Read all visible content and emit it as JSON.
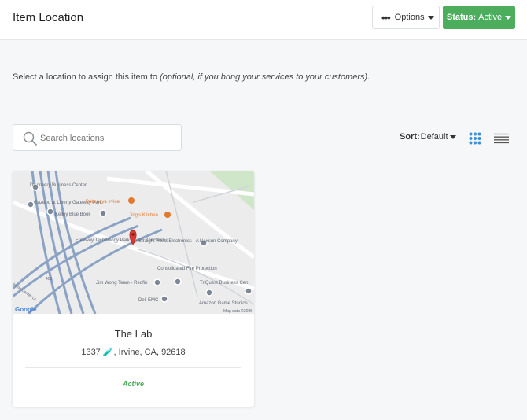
{
  "header": {
    "title": "Item Location",
    "options_label": "Options",
    "status_prefix": "Status:",
    "status_value": "Active",
    "status_color": "#4cae5c"
  },
  "instructions": {
    "text": "Select a location to assign this item to ",
    "note": "(optional, if you bring your services to your customers)."
  },
  "search": {
    "placeholder": "Search locations",
    "value": ""
  },
  "sort": {
    "label": "Sort:",
    "value": "Default"
  },
  "view_toggle": {
    "active": "grid",
    "grid_icon": "grid-icon",
    "list_icon": "list-icon"
  },
  "locations": [
    {
      "name": "The Lab",
      "address": "1337 🧪, Irvine, CA, 92618",
      "status": "Active",
      "map": {
        "labels": [
          "Discovery Business Center",
          "Gazebo at Liberty Gateway Park",
          "Kelley Blue Book",
          "Pokenoya Irvine",
          "Jing's Kitchen",
          "Freeway Technology Park · Tech Spectrum",
          "Straight Road Electronics · A Nexsun Company",
          "Consolidated Fire Protection",
          "Jim Wong Team - Redfin",
          "TriQuest Business Cen",
          "Dell EMC",
          "Amazon Game Studios"
        ],
        "road_labels": [
          "405",
          "Irvine Center Dr"
        ],
        "attribution": "Map data ©2025",
        "logo": "Google"
      }
    }
  ]
}
